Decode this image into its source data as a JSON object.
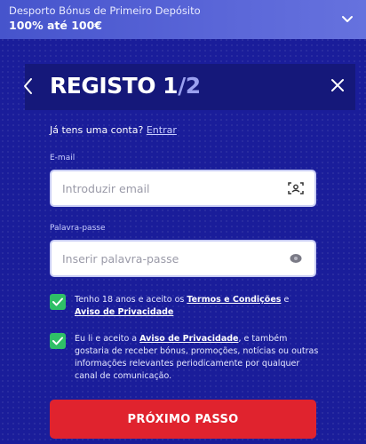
{
  "promo": {
    "subtitle": "Desporto Bónus de Primeiro Depósito",
    "headline": "100% até 100€"
  },
  "header": {
    "title_main": "REGISTO 1",
    "title_sep": "/",
    "title_total": "2"
  },
  "account": {
    "question": "Já tens uma conta?",
    "login_link": "Entrar"
  },
  "form": {
    "email_label": "E-mail",
    "email_placeholder": "Introduzir email",
    "password_label": "Palavra-passe",
    "password_placeholder": "Inserir palavra-passe"
  },
  "consents": {
    "age_prefix": "Tenho 18 anos e aceito os ",
    "age_terms_link": "Termos e Condições",
    "age_and": " e",
    "age_privacy_link": "Aviso de Privacidade",
    "marketing_prefix": "Eu li e aceito a ",
    "marketing_privacy_link": "Aviso de Privacidade",
    "marketing_rest": ", e também gostaria de receber bónus, promoções, notícias ou outras informações relevantes periodicamente por qualquer canal de comunicação."
  },
  "cta": {
    "next_label": "PRÓXIMO PASSO"
  },
  "colors": {
    "background": "#1a1d9a",
    "promo_bar": "#5a66d8",
    "checkbox": "#2fbf67",
    "cta": "#e0232e"
  }
}
